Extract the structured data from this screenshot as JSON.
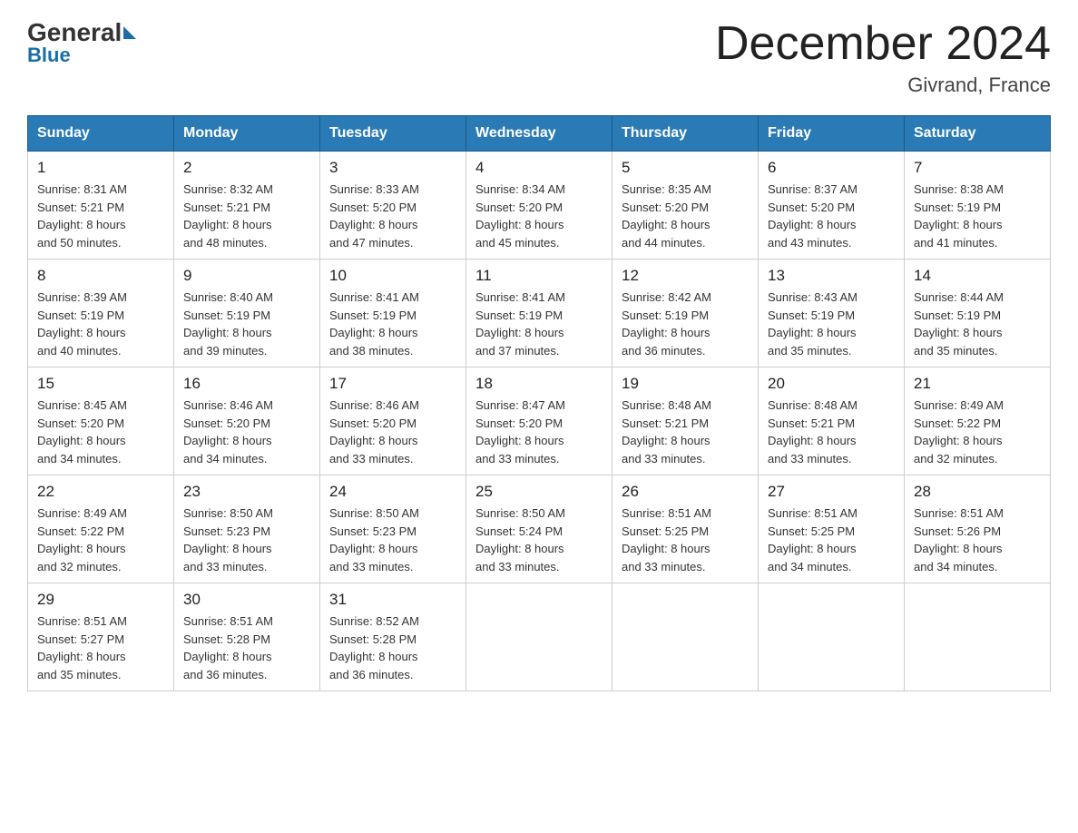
{
  "header": {
    "logo_general": "General",
    "logo_blue": "Blue",
    "month_title": "December 2024",
    "location": "Givrand, France"
  },
  "days_of_week": [
    "Sunday",
    "Monday",
    "Tuesday",
    "Wednesday",
    "Thursday",
    "Friday",
    "Saturday"
  ],
  "weeks": [
    [
      {
        "day": "1",
        "info": "Sunrise: 8:31 AM\nSunset: 5:21 PM\nDaylight: 8 hours\nand 50 minutes."
      },
      {
        "day": "2",
        "info": "Sunrise: 8:32 AM\nSunset: 5:21 PM\nDaylight: 8 hours\nand 48 minutes."
      },
      {
        "day": "3",
        "info": "Sunrise: 8:33 AM\nSunset: 5:20 PM\nDaylight: 8 hours\nand 47 minutes."
      },
      {
        "day": "4",
        "info": "Sunrise: 8:34 AM\nSunset: 5:20 PM\nDaylight: 8 hours\nand 45 minutes."
      },
      {
        "day": "5",
        "info": "Sunrise: 8:35 AM\nSunset: 5:20 PM\nDaylight: 8 hours\nand 44 minutes."
      },
      {
        "day": "6",
        "info": "Sunrise: 8:37 AM\nSunset: 5:20 PM\nDaylight: 8 hours\nand 43 minutes."
      },
      {
        "day": "7",
        "info": "Sunrise: 8:38 AM\nSunset: 5:19 PM\nDaylight: 8 hours\nand 41 minutes."
      }
    ],
    [
      {
        "day": "8",
        "info": "Sunrise: 8:39 AM\nSunset: 5:19 PM\nDaylight: 8 hours\nand 40 minutes."
      },
      {
        "day": "9",
        "info": "Sunrise: 8:40 AM\nSunset: 5:19 PM\nDaylight: 8 hours\nand 39 minutes."
      },
      {
        "day": "10",
        "info": "Sunrise: 8:41 AM\nSunset: 5:19 PM\nDaylight: 8 hours\nand 38 minutes."
      },
      {
        "day": "11",
        "info": "Sunrise: 8:41 AM\nSunset: 5:19 PM\nDaylight: 8 hours\nand 37 minutes."
      },
      {
        "day": "12",
        "info": "Sunrise: 8:42 AM\nSunset: 5:19 PM\nDaylight: 8 hours\nand 36 minutes."
      },
      {
        "day": "13",
        "info": "Sunrise: 8:43 AM\nSunset: 5:19 PM\nDaylight: 8 hours\nand 35 minutes."
      },
      {
        "day": "14",
        "info": "Sunrise: 8:44 AM\nSunset: 5:19 PM\nDaylight: 8 hours\nand 35 minutes."
      }
    ],
    [
      {
        "day": "15",
        "info": "Sunrise: 8:45 AM\nSunset: 5:20 PM\nDaylight: 8 hours\nand 34 minutes."
      },
      {
        "day": "16",
        "info": "Sunrise: 8:46 AM\nSunset: 5:20 PM\nDaylight: 8 hours\nand 34 minutes."
      },
      {
        "day": "17",
        "info": "Sunrise: 8:46 AM\nSunset: 5:20 PM\nDaylight: 8 hours\nand 33 minutes."
      },
      {
        "day": "18",
        "info": "Sunrise: 8:47 AM\nSunset: 5:20 PM\nDaylight: 8 hours\nand 33 minutes."
      },
      {
        "day": "19",
        "info": "Sunrise: 8:48 AM\nSunset: 5:21 PM\nDaylight: 8 hours\nand 33 minutes."
      },
      {
        "day": "20",
        "info": "Sunrise: 8:48 AM\nSunset: 5:21 PM\nDaylight: 8 hours\nand 33 minutes."
      },
      {
        "day": "21",
        "info": "Sunrise: 8:49 AM\nSunset: 5:22 PM\nDaylight: 8 hours\nand 32 minutes."
      }
    ],
    [
      {
        "day": "22",
        "info": "Sunrise: 8:49 AM\nSunset: 5:22 PM\nDaylight: 8 hours\nand 32 minutes."
      },
      {
        "day": "23",
        "info": "Sunrise: 8:50 AM\nSunset: 5:23 PM\nDaylight: 8 hours\nand 33 minutes."
      },
      {
        "day": "24",
        "info": "Sunrise: 8:50 AM\nSunset: 5:23 PM\nDaylight: 8 hours\nand 33 minutes."
      },
      {
        "day": "25",
        "info": "Sunrise: 8:50 AM\nSunset: 5:24 PM\nDaylight: 8 hours\nand 33 minutes."
      },
      {
        "day": "26",
        "info": "Sunrise: 8:51 AM\nSunset: 5:25 PM\nDaylight: 8 hours\nand 33 minutes."
      },
      {
        "day": "27",
        "info": "Sunrise: 8:51 AM\nSunset: 5:25 PM\nDaylight: 8 hours\nand 34 minutes."
      },
      {
        "day": "28",
        "info": "Sunrise: 8:51 AM\nSunset: 5:26 PM\nDaylight: 8 hours\nand 34 minutes."
      }
    ],
    [
      {
        "day": "29",
        "info": "Sunrise: 8:51 AM\nSunset: 5:27 PM\nDaylight: 8 hours\nand 35 minutes."
      },
      {
        "day": "30",
        "info": "Sunrise: 8:51 AM\nSunset: 5:28 PM\nDaylight: 8 hours\nand 36 minutes."
      },
      {
        "day": "31",
        "info": "Sunrise: 8:52 AM\nSunset: 5:28 PM\nDaylight: 8 hours\nand 36 minutes."
      },
      null,
      null,
      null,
      null
    ]
  ]
}
